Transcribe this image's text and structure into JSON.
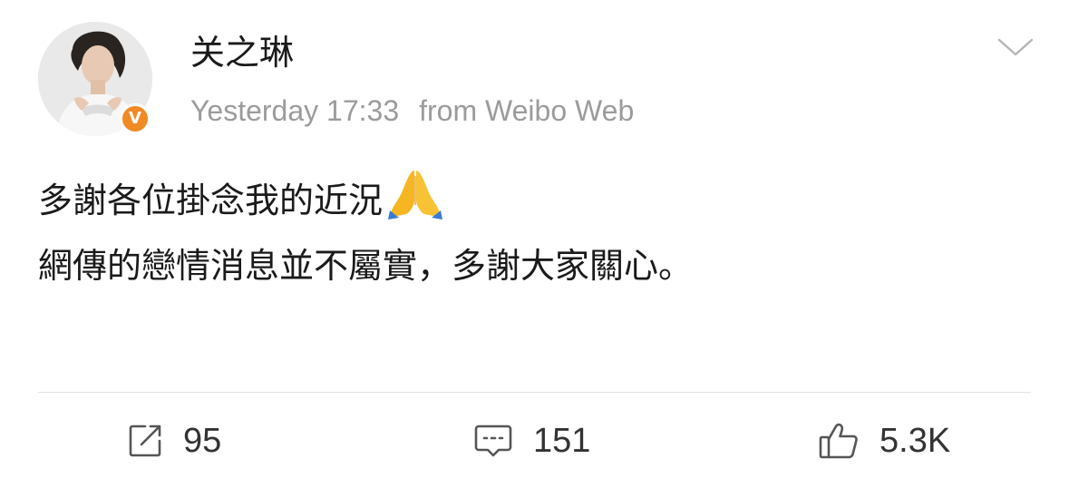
{
  "post": {
    "author": "关之琳",
    "verified_badge": "V",
    "timestamp": "Yesterday 17:33",
    "source": "from Weibo Web",
    "body_lines": [
      "多謝各位掛念我的近況",
      "網傳的戀情消息並不屬實，多謝大家關心。"
    ],
    "emoji": "folded-hands-icon"
  },
  "actions": {
    "repost_count": "95",
    "comment_count": "151",
    "like_count": "5.3K"
  },
  "colors": {
    "badge": "#f08a24",
    "meta_text": "#9b9b9b",
    "body_text": "#1a1a1a",
    "divider": "#e3e3e3",
    "icon": "#555555"
  }
}
